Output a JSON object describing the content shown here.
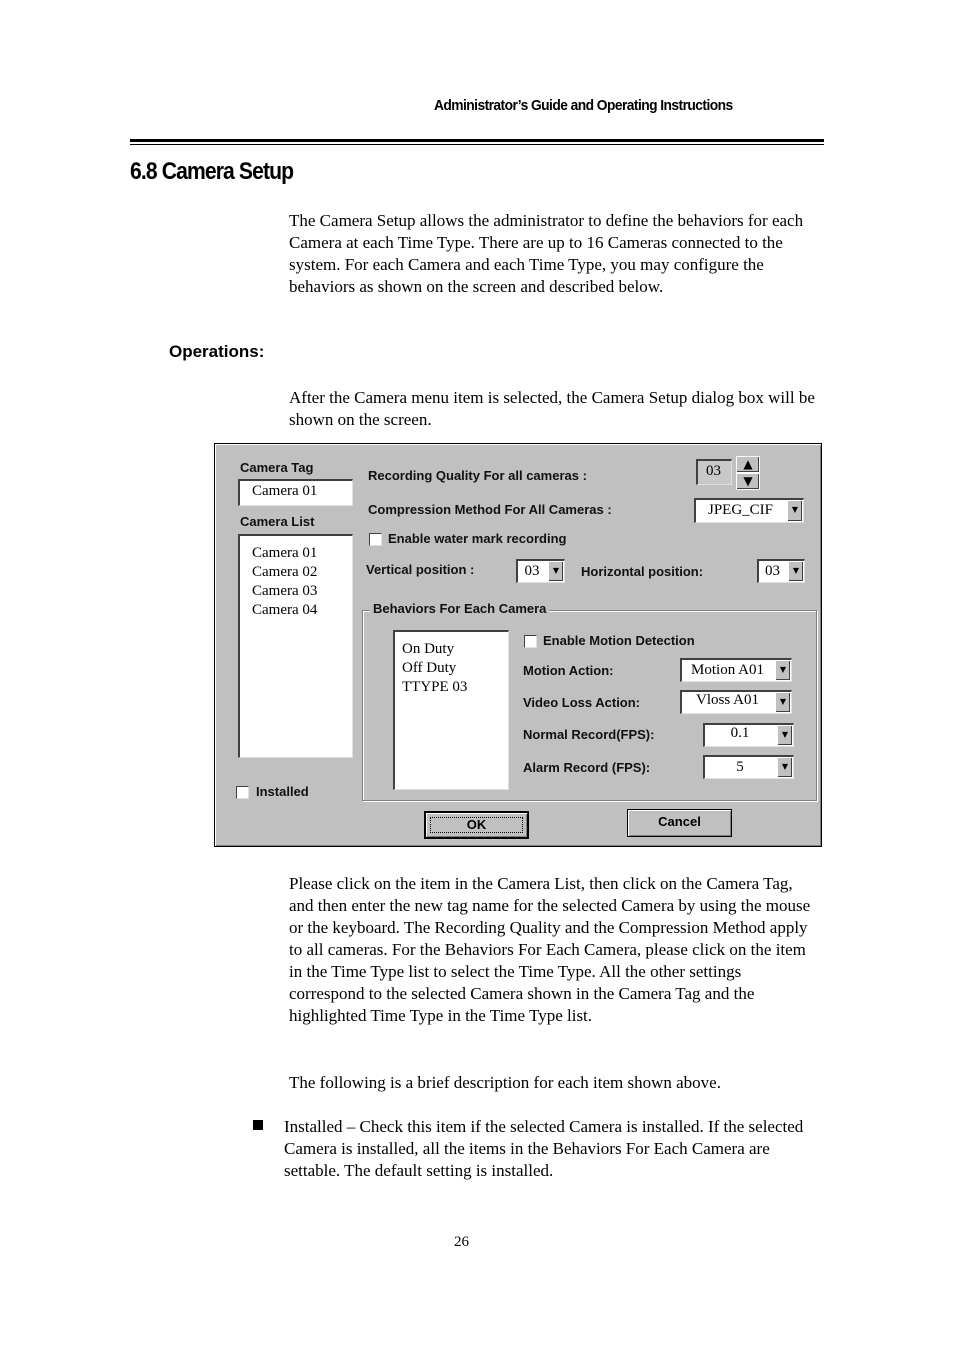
{
  "header": {
    "running_title": "Administrator’s Guide and Operating Instructions"
  },
  "section": {
    "title": "6.8 Camera Setup"
  },
  "intro": "The Camera Setup allows the administrator to define the behaviors for each Camera at each Time Type.   There are up to 16 Cameras connected to the system.   For each Camera and each Time Type, you may configure the behaviors as shown on the screen and described below.",
  "operations_heading": "Operations:",
  "operations_text": "After the Camera menu item is selected, the Camera Setup dialog box will be shown on the screen.",
  "dialog": {
    "camera_tag_label": "Camera Tag",
    "camera_tag_value": "Camera 01",
    "camera_list_label": "Camera List",
    "camera_list": [
      "Camera 01",
      "Camera 02",
      "Camera 03",
      "Camera 04"
    ],
    "installed_label": "Installed",
    "installed_checked": false,
    "recording_quality_label": "Recording Quality For all cameras :",
    "recording_quality_value": "03",
    "spin_up": "▲",
    "spin_down": "▼",
    "compression_label": "Compression Method For All Cameras :",
    "compression_value": "JPEG_CIF",
    "watermark_label": "Enable water mark recording",
    "watermark_checked": false,
    "vertical_label": "Vertical position :",
    "vertical_value": "03",
    "horizontal_label": "Horizontal position:",
    "horizontal_value": "03",
    "behaviors_group_label": "Behaviors For Each Camera",
    "time_types": [
      "On Duty",
      "Off Duty",
      "TTYPE 03"
    ],
    "motion_detection_label": "Enable Motion Detection",
    "motion_detection_checked": false,
    "motion_action_label": "Motion Action:",
    "motion_action_value": "Motion A01",
    "video_loss_label": "Video Loss Action:",
    "video_loss_value": "Vloss A01",
    "normal_record_label": "Normal Record(FPS):",
    "normal_record_value": "0.1",
    "alarm_record_label": "Alarm Record (FPS):",
    "alarm_record_value": "5",
    "combo_arrow": "▼",
    "ok_label": "OK",
    "cancel_label": "Cancel"
  },
  "description": "Please click on the item in the Camera List, then click on the Camera Tag, and then enter the new tag name for the selected Camera by using the mouse or the keyboard.   The Recording Quality and the Compression Method apply to all cameras.   For the Behaviors For Each Camera, please click on the item in the Time Type list to select the Time Type.   All the other settings correspond to the selected Camera shown in the Camera Tag and the highlighted Time Type in the Time Type list.",
  "brief_intro": "The following is a brief description for each item shown above.",
  "bullets": [
    "Installed – Check this item if the selected Camera is installed.   If the selected Camera is installed, all the items in the Behaviors For Each Camera are settable.   The default setting is installed."
  ],
  "page_number": "26"
}
